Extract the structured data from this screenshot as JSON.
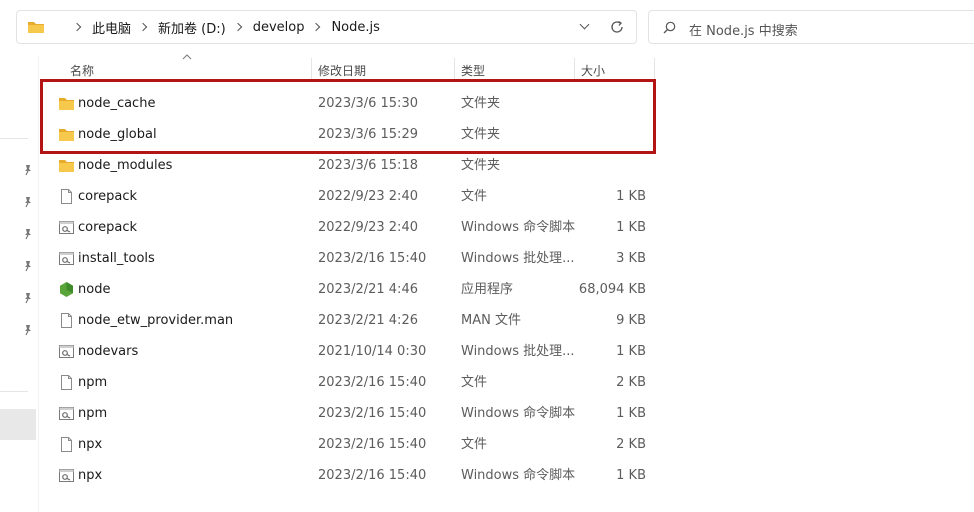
{
  "address_bar": {
    "crumbs": [
      "此电脑",
      "新加卷 (D:)",
      "develop",
      "Node.js"
    ]
  },
  "search": {
    "placeholder": "在 Node.js 中搜索"
  },
  "columns": {
    "name": "名称",
    "date": "修改日期",
    "type": "类型",
    "size": "大小"
  },
  "files": [
    {
      "name": "node_cache",
      "date": "2023/3/6 15:30",
      "type": "文件夹",
      "size": "",
      "icon": "folder-icon"
    },
    {
      "name": "node_global",
      "date": "2023/3/6 15:29",
      "type": "文件夹",
      "size": "",
      "icon": "folder-icon"
    },
    {
      "name": "node_modules",
      "date": "2023/3/6 15:18",
      "type": "文件夹",
      "size": "",
      "icon": "folder-icon"
    },
    {
      "name": "corepack",
      "date": "2022/9/23 2:40",
      "type": "文件",
      "size": "1 KB",
      "icon": "file-icon"
    },
    {
      "name": "corepack",
      "date": "2022/9/23 2:40",
      "type": "Windows 命令脚本",
      "size": "1 KB",
      "icon": "script-icon"
    },
    {
      "name": "install_tools",
      "date": "2023/2/16 15:40",
      "type": "Windows 批处理...",
      "size": "3 KB",
      "icon": "script-icon"
    },
    {
      "name": "node",
      "date": "2023/2/21 4:46",
      "type": "应用程序",
      "size": "68,094 KB",
      "icon": "nodejs-icon"
    },
    {
      "name": "node_etw_provider.man",
      "date": "2023/2/21 4:26",
      "type": "MAN 文件",
      "size": "9 KB",
      "icon": "file-icon"
    },
    {
      "name": "nodevars",
      "date": "2021/10/14 0:30",
      "type": "Windows 批处理...",
      "size": "1 KB",
      "icon": "script-icon"
    },
    {
      "name": "npm",
      "date": "2023/2/16 15:40",
      "type": "文件",
      "size": "2 KB",
      "icon": "file-icon"
    },
    {
      "name": "npm",
      "date": "2023/2/16 15:40",
      "type": "Windows 命令脚本",
      "size": "1 KB",
      "icon": "script-icon"
    },
    {
      "name": "npx",
      "date": "2023/2/16 15:40",
      "type": "文件",
      "size": "2 KB",
      "icon": "file-icon"
    },
    {
      "name": "npx",
      "date": "2023/2/16 15:40",
      "type": "Windows 命令脚本",
      "size": "1 KB",
      "icon": "script-icon"
    }
  ],
  "colors": {
    "highlight": "#b31414",
    "folder": "#f4c54a"
  }
}
